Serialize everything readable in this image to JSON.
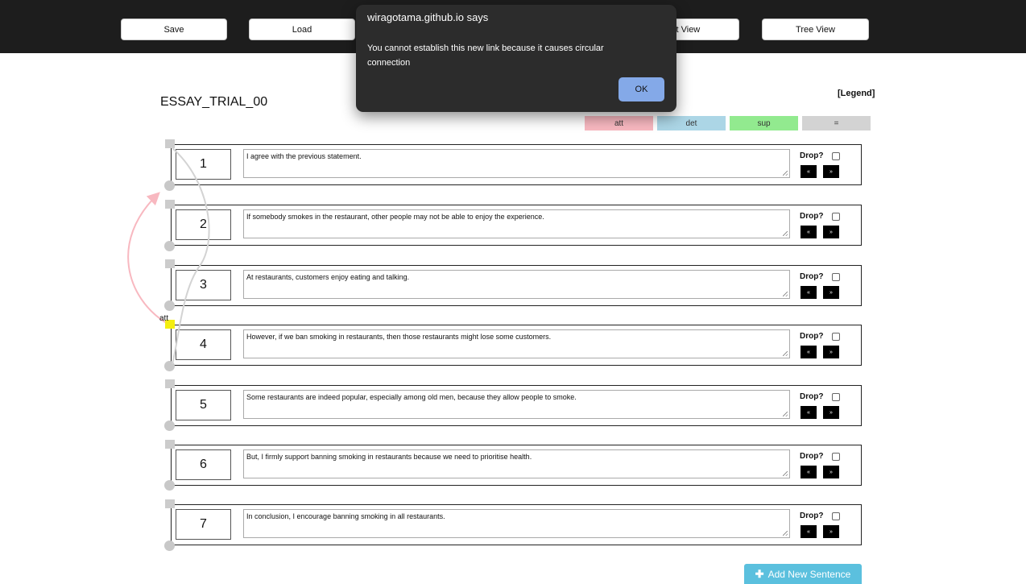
{
  "toolbar": {
    "save_label": "Save",
    "load_label": "Load",
    "text_view_label": "xt View",
    "tree_view_label": "Tree View"
  },
  "document": {
    "title": "ESSAY_TRIAL_00"
  },
  "legend": {
    "title": "[Legend]",
    "items": [
      {
        "label": "att",
        "color": "#f8b8c0"
      },
      {
        "label": "det",
        "color": "#acd6e6"
      },
      {
        "label": "sup",
        "color": "#92ea8f"
      },
      {
        "label": "=",
        "color": "#d3d3d3"
      }
    ]
  },
  "sentences": [
    {
      "number": "1",
      "text": "I agree with the previous statement.",
      "drop_label": "Drop?",
      "move_up": "«",
      "move_down": "»"
    },
    {
      "number": "2",
      "text": "If somebody smokes in the restaurant, other people may not be able to enjoy the experience.",
      "drop_label": "Drop?",
      "move_up": "«",
      "move_down": "»"
    },
    {
      "number": "3",
      "text": "At restaurants, customers enjoy eating and talking.",
      "drop_label": "Drop?",
      "move_up": "«",
      "move_down": "»"
    },
    {
      "number": "4",
      "text": "However, if we ban smoking in restaurants, then those restaurants might lose some customers.",
      "drop_label": "Drop?",
      "move_up": "«",
      "move_down": "»"
    },
    {
      "number": "5",
      "text": "Some restaurants are indeed popular, especially among old men, because they allow people to smoke.",
      "drop_label": "Drop?",
      "move_up": "«",
      "move_down": "»"
    },
    {
      "number": "6",
      "text": "But, I firmly support banning smoking in restaurants because we need to prioritise health.",
      "drop_label": "Drop?",
      "move_up": "«",
      "move_down": "»"
    },
    {
      "number": "7",
      "text": "In conclusion, I encourage banning smoking in all restaurants.",
      "drop_label": "Drop?",
      "move_up": "«",
      "move_down": "»"
    }
  ],
  "link_label": "att",
  "link_colors": {
    "att": "#f8b8c0",
    "equal": "#d3d3d3",
    "selected_handle": "#f4ee0f"
  },
  "add_button": {
    "icon": "plus-icon",
    "label": "Add New Sentence"
  },
  "dialog": {
    "title": "wiragotama.github.io says",
    "message": "You cannot establish this new link because it causes circular connection",
    "ok_label": "OK"
  }
}
